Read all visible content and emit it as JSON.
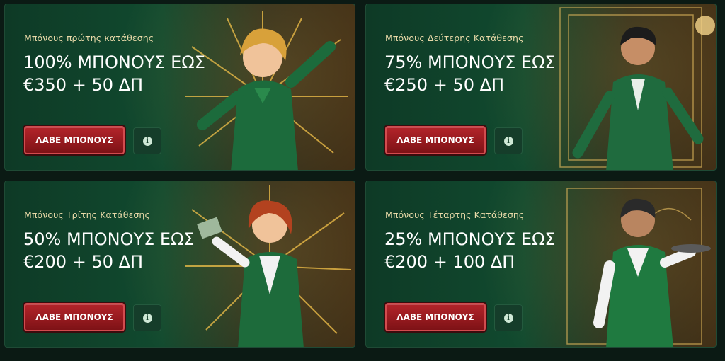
{
  "cards": [
    {
      "subtitle": "Μπόνους πρώτης κατάθεσης",
      "headline_1": "100% ΜΠΟΝΟΥΣ ΕΩΣ",
      "headline_2": "€350 + 50 ΔΠ",
      "cta": "ΛΑΒΕ ΜΠΟΝΟΥΣ",
      "info_icon": "i"
    },
    {
      "subtitle": "Μπόνους Δεύτερης Κατάθεσης",
      "headline_1": "75% ΜΠΟΝΟΥΣ ΕΩΣ",
      "headline_2": "€250 + 50 ΔΠ",
      "cta": "ΛΑΒΕ ΜΠΟΝΟΥΣ",
      "info_icon": "i"
    },
    {
      "subtitle": "Μπόνους Τρίτης Κατάθεσης",
      "headline_1": "50% ΜΠΟΝΟΥΣ ΕΩΣ",
      "headline_2": "€200 + 50 ΔΠ",
      "cta": "ΛΑΒΕ ΜΠΟΝΟΥΣ",
      "info_icon": "i"
    },
    {
      "subtitle": "Μπόνους Τέταρτης Κατάθεσης",
      "headline_1": "25% ΜΠΟΝΟΥΣ ΕΩΣ",
      "headline_2": "€200 + 100 ΔΠ",
      "cta": "ΛΑΒΕ ΜΠΟΝΟΥΣ",
      "info_icon": "i"
    }
  ],
  "colors": {
    "accent_red": "#b3242a",
    "card_green": "#114a2f",
    "subtitle_gold": "#e8d9a8"
  }
}
